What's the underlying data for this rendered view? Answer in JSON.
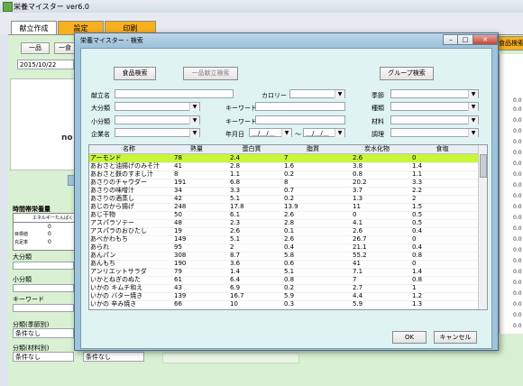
{
  "window": {
    "title": "栄養マイスター ver6.0"
  },
  "tabs": [
    "献立作成",
    "設定",
    "印刷"
  ],
  "left": {
    "btn_ippin": "一品",
    "btn_ikkon": "一食",
    "date": "2015/10/22",
    "no_label": "no",
    "nutrition_title": "時間帯栄養量",
    "nutrition_headers": [
      "エネルギー",
      "たんぱく"
    ],
    "nutrition_rows": [
      {
        "label": "",
        "v1": "0",
        "v2": ""
      },
      {
        "label": "目標値",
        "v1": "0",
        "v2": ""
      },
      {
        "label": "充足率",
        "v1": "0",
        "v2": ""
      }
    ],
    "daibunrui": "大分類",
    "shoubunrui": "小分類",
    "keyword": "キーワード",
    "bunrui_kisetsu": "分類(季節別)",
    "bunrui_zairyou": "分類(材料別)",
    "jouken_nashi": "条件なし",
    "jouken_nashi2": "条件なし",
    "jouken_nashi3": "条件なし"
  },
  "right": {
    "button": "食品検索",
    "numbers": [
      "0.0",
      "0.0",
      "0.0",
      "0.0",
      "0.0",
      "0.0",
      "0.0",
      "0.0",
      "0.0",
      "0.0",
      "0.0",
      "0.0",
      "0.0",
      "0.0",
      "0.0",
      "0.0",
      "0.0",
      "0.0",
      "0.0",
      "0.0",
      "0.0",
      "0.0",
      "0.0",
      "0.0"
    ]
  },
  "dialog": {
    "title": "栄養マイスター - 検索",
    "btn_shokuhin": "食品検索",
    "btn_ippin": "一品献立検索",
    "btn_group": "グループ検索",
    "labels": {
      "kondate": "献立名",
      "calorie": "カロリー",
      "kisetsu": "季節",
      "daibunrui": "大分類",
      "keyword1": "キーワード",
      "shurui": "種類",
      "shoubunrui": "小分類",
      "keyword2": "キーワード",
      "zairyou": "材料",
      "kigyou": "企業名",
      "nengappi": "年月日",
      "date_from": "＿/＿/＿",
      "tilde": "～",
      "date_to": "＿/＿/＿",
      "chouri": "調理"
    },
    "table": {
      "headers": [
        "名称",
        "熱量",
        "蛋白質",
        "脂質",
        "炭水化物",
        "食塩"
      ],
      "rows": [
        [
          "アーモンド",
          "78",
          "2.4",
          "7",
          "2.6",
          "0"
        ],
        [
          "あおさと油揚げのみそ汁",
          "41",
          "2.8",
          "1.6",
          "3.8",
          "1.4"
        ],
        [
          "あおさと麩のすまし汁",
          "8",
          "1.1",
          "0.2",
          "0.8",
          "1.1"
        ],
        [
          "あさりのチャウダー",
          "191",
          "6.8",
          "8",
          "20.2",
          "3.3"
        ],
        [
          "あさりの味噌汁",
          "34",
          "3.3",
          "0.7",
          "3.7",
          "2.2"
        ],
        [
          "あさりの酒蒸し",
          "42",
          "5.1",
          "0.2",
          "1.3",
          "2"
        ],
        [
          "あじのから揚げ",
          "248",
          "17.8",
          "13.9",
          "11",
          "1.5"
        ],
        [
          "あじ干物",
          "50",
          "6.1",
          "2.6",
          "0",
          "0.5"
        ],
        [
          "アスパラソテー",
          "48",
          "2.3",
          "2.8",
          "4.1",
          "0.5"
        ],
        [
          "アスパラのおひたし",
          "19",
          "2.6",
          "0.1",
          "2.6",
          "0.4"
        ],
        [
          "あべかわもち",
          "149",
          "5.1",
          "2.6",
          "26.7",
          "0"
        ],
        [
          "あられ",
          "95",
          "2",
          "0.4",
          "21.1",
          "0.4"
        ],
        [
          "あんパン",
          "308",
          "8.7",
          "5.8",
          "55.2",
          "0.8"
        ],
        [
          "あんもち",
          "190",
          "3.6",
          "0.6",
          "41",
          "0"
        ],
        [
          "アンリエットサラダ",
          "79",
          "1.4",
          "5.1",
          "7.1",
          "1.4"
        ],
        [
          "いかとねぎのぬた",
          "61",
          "6.4",
          "0.8",
          "7",
          "0.8"
        ],
        [
          "いかの キムチ和え",
          "43",
          "6.9",
          "0.2",
          "2.7",
          "1"
        ],
        [
          "いかの バター焼き",
          "139",
          "16.7",
          "5.9",
          "4.4",
          "1.2"
        ],
        [
          "いかの 辛み焼き",
          "66",
          "10",
          "0.3",
          "5.9",
          "1.3"
        ]
      ]
    },
    "ok": "OK",
    "cancel": "キャンセル"
  }
}
